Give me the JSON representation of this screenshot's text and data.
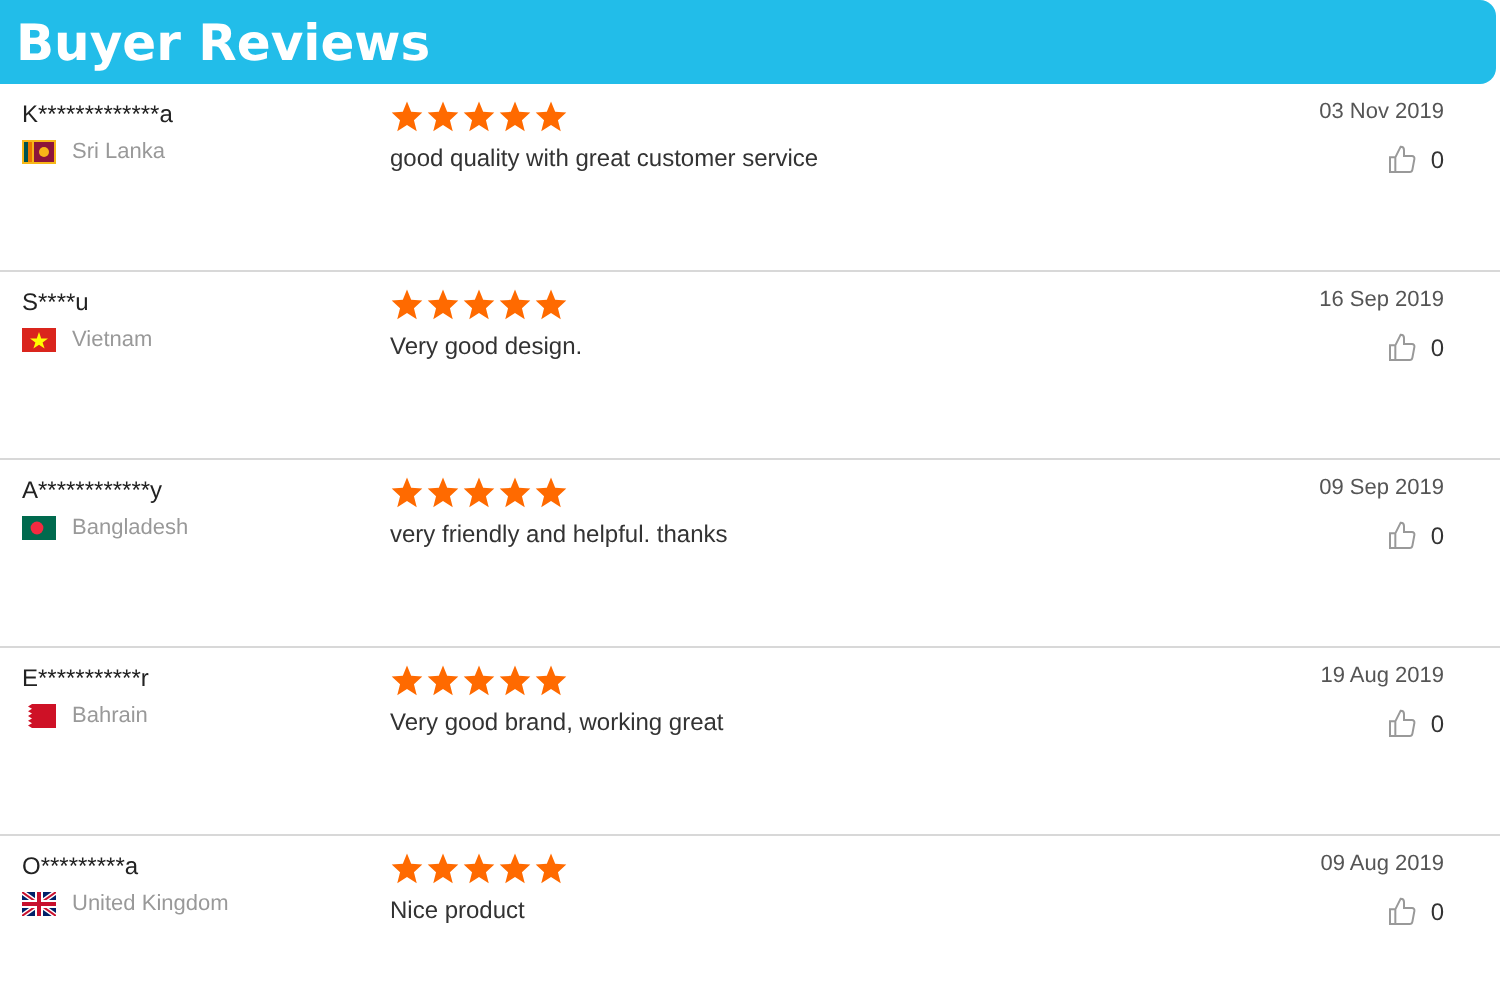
{
  "header": {
    "title": "Buyer Reviews"
  },
  "reviews": [
    {
      "buyer": "K*************a",
      "country": "Sri Lanka",
      "kind": "sri-lanka",
      "stars": 5,
      "text": "good quality with great customer service",
      "date": "03 Nov 2019",
      "likes": "0"
    },
    {
      "buyer": "S****u",
      "country": "Vietnam",
      "kind": "vietnam",
      "stars": 5,
      "text": "Very good design.",
      "date": "16 Sep 2019",
      "likes": "0"
    },
    {
      "buyer": "A************y",
      "country": "Bangladesh",
      "kind": "bangladesh",
      "stars": 5,
      "text": "very friendly and helpful. thanks",
      "date": "09 Sep 2019",
      "likes": "0"
    },
    {
      "buyer": "E***********r",
      "country": "Bahrain",
      "kind": "bahrain",
      "stars": 5,
      "text": "Very good brand, working great",
      "date": "19 Aug 2019",
      "likes": "0"
    },
    {
      "buyer": "O*********a",
      "country": "United Kingdom",
      "kind": "united-kingdom",
      "stars": 5,
      "text": "Nice product",
      "date": "09 Aug 2019",
      "likes": "0"
    }
  ]
}
